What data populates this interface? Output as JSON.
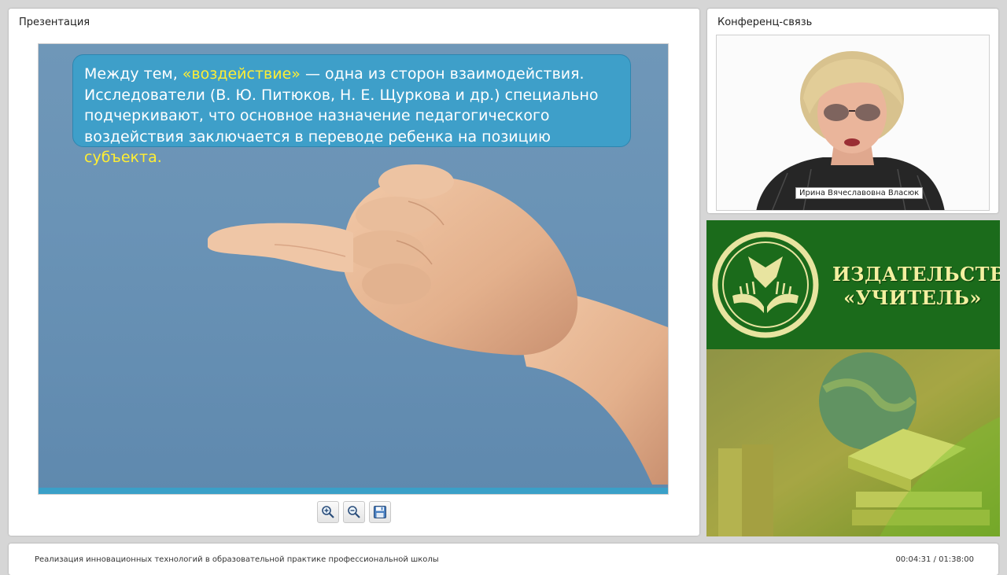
{
  "presentation": {
    "title": "Презентация",
    "slide": {
      "text_1": "Между тем, ",
      "text_hl_1": "«воздействие»",
      "text_2": " — одна из сторон взаимодействия. Исследователи (В. Ю. Питюков, Н. Е. Щуркова и др.) специально подчеркивают, что основное назначение педагогического воздействия заключается в переводе ребенка на позицию ",
      "text_hl_2": "субъекта",
      "text_3": "."
    },
    "toolbar": {
      "zoom_in_icon": "zoom-in-icon",
      "zoom_out_icon": "zoom-out-icon",
      "save_icon": "floppy-disk-icon"
    }
  },
  "conference": {
    "title": "Конференц-связь",
    "speaker_name": "Ирина Вячеславовна Власюк"
  },
  "ad": {
    "publisher_line1": "ИЗДАТЕЛЬСТВО",
    "publisher_line2": "«УЧИТЕЛЬ»"
  },
  "footer": {
    "course_title": "Реализация инновационных технологий в образовательной практике профессиональной школы",
    "time": "00:04:31 / 01:38:00"
  },
  "colors": {
    "slide_background": "#6a93b6",
    "text_box": "#3e9fc9",
    "highlight": "#ffee33",
    "banner_green": "#1b6b1b"
  }
}
